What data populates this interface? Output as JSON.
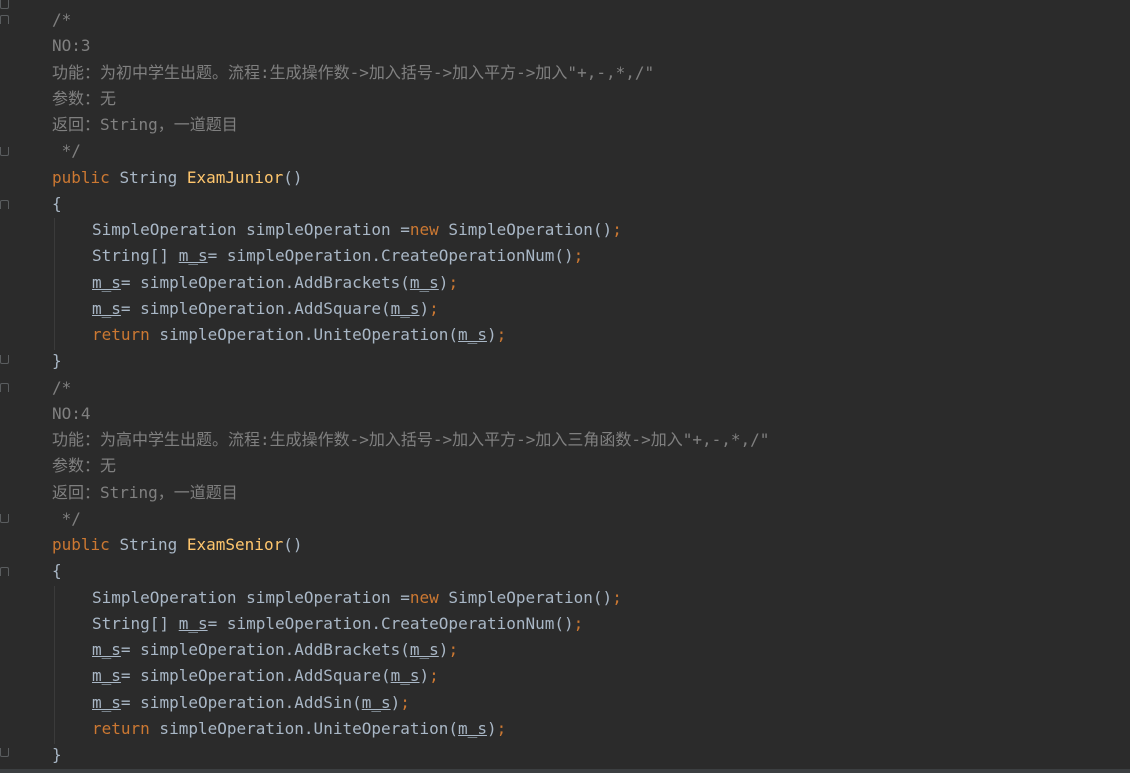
{
  "editor": {
    "block1": {
      "comment_open": "/*",
      "no": "NO:3",
      "func": "功能：为初中学生出题。流程:生成操作数->加入括号->加入平方->加入\"+,-,*,/\"",
      "param": "参数：无",
      "ret": "返回：String，一道题目",
      "comment_close": " */",
      "kw_public": "public",
      "type_string": "String",
      "method_name": "ExamJunior",
      "parens": "()",
      "brace_open": "{",
      "brace_close": "}"
    },
    "block2": {
      "comment_open": "/*",
      "no": "NO:4",
      "func": "功能：为高中学生出题。流程:生成操作数->加入括号->加入平方->加入三角函数->加入\"+,-,*,/\"",
      "param": "参数：无",
      "ret": "返回：String，一道题目",
      "comment_close": " */",
      "kw_public": "public",
      "type_string": "String",
      "method_name": "ExamSenior",
      "parens": "()",
      "brace_open": "{",
      "brace_close": "}"
    },
    "tokens": {
      "simple_operation_decl": "SimpleOperation simpleOperation =",
      "new_kw": "new",
      "simple_operation_ctor": " SimpleOperation()",
      "semi": ";",
      "string_arr": "String[] ",
      "m_s": "m_s",
      "assign_create": "= simpleOperation.CreateOperationNum()",
      "assign_brackets_pre": "= simpleOperation.AddBrackets(",
      "assign_square_pre": "= simpleOperation.AddSquare(",
      "assign_sin_pre": "= simpleOperation.AddSin(",
      "close_paren": ")",
      "return_kw": "return",
      "unite_pre": " simpleOperation.UniteOperation("
    }
  }
}
